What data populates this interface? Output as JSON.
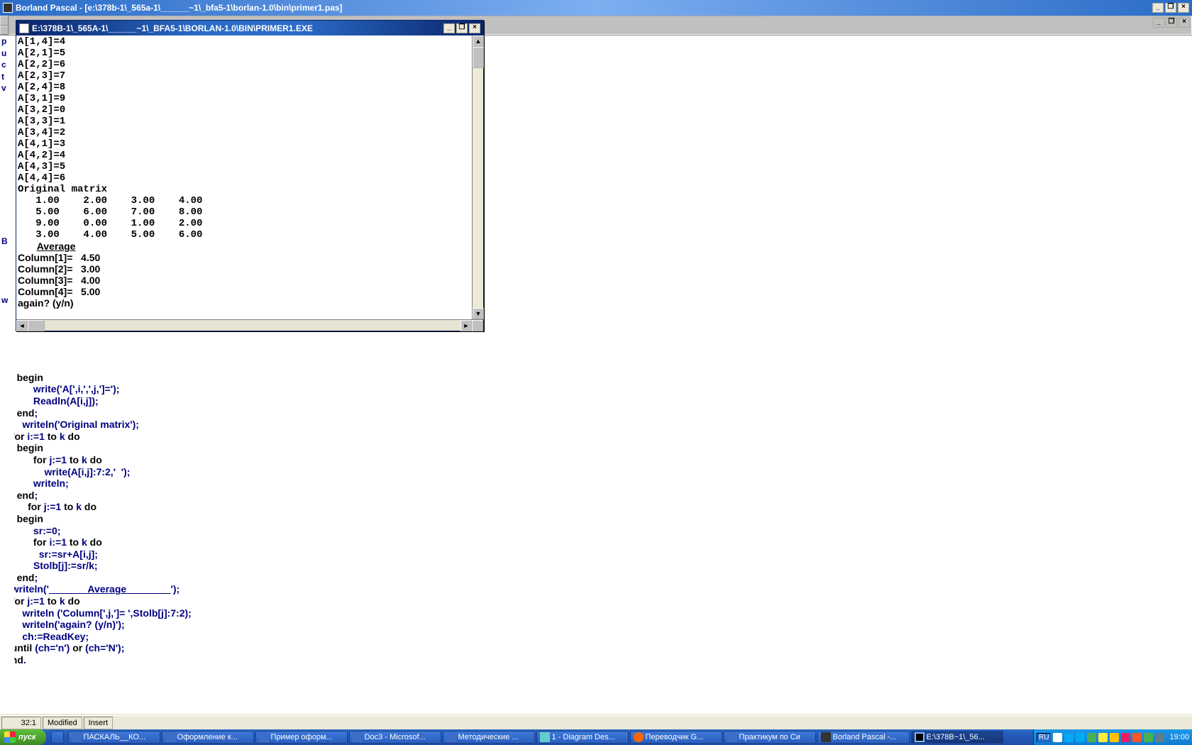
{
  "main_window": {
    "title": "Borland Pascal - [e:\\378b-1\\_565a-1\\______~1\\_bfa5-1\\borlan-1.0\\bin\\primer1.pas]"
  },
  "inner_window": {
    "title": "E:\\378B-1\\_565A-1\\______~1\\_BFA5-1\\BORLAN-1.0\\BIN\\PRIMER1.EXE"
  },
  "console_output": {
    "matrix_inputs": [
      "A[1,4]=4",
      "A[2,1]=5",
      "A[2,2]=6",
      "A[2,3]=7",
      "A[2,4]=8",
      "A[3,1]=9",
      "A[3,2]=0",
      "A[3,3]=1",
      "A[3,4]=2",
      "A[4,1]=3",
      "A[4,2]=4",
      "A[4,3]=5",
      "A[4,4]=6"
    ],
    "header1": "Original matrix",
    "matrix_rows": [
      "   1.00    2.00    3.00    4.00",
      "   5.00    6.00    7.00    8.00",
      "   9.00    0.00    1.00    2.00",
      "   3.00    4.00    5.00    6.00"
    ],
    "avg_header_pre": "       ",
    "avg_header_u": "Average",
    "columns": [
      "Column[1]=   4.50",
      "Column[2]=   3.00",
      "Column[3]=   4.00",
      "Column[4]=   5.00"
    ],
    "prompt": "again? (y/n)"
  },
  "left_strip": [
    "p",
    "u",
    "c",
    "t",
    "v",
    " ",
    " ",
    " ",
    " ",
    " ",
    " ",
    " ",
    " ",
    " ",
    " ",
    " ",
    " ",
    "B",
    " ",
    " ",
    " ",
    " ",
    "w"
  ],
  "source_lines": [
    {
      "indent": 4,
      "parts": [
        {
          "t": "begin",
          "c": "kw"
        }
      ]
    },
    {
      "indent": 10,
      "parts": [
        {
          "t": "write(",
          "c": "reg"
        },
        {
          "t": "'A['",
          "c": "str"
        },
        {
          "t": ",i,",
          "c": "reg"
        },
        {
          "t": "','",
          "c": "str"
        },
        {
          "t": ",j,",
          "c": "reg"
        },
        {
          "t": "']='",
          "c": "str"
        },
        {
          "t": ");",
          "c": "reg"
        }
      ]
    },
    {
      "indent": 10,
      "parts": [
        {
          "t": "Readln(A[i,j]);",
          "c": "reg"
        }
      ]
    },
    {
      "indent": 4,
      "parts": [
        {
          "t": "end",
          "c": "kw"
        },
        {
          "t": ";",
          "c": "reg"
        }
      ]
    },
    {
      "indent": 6,
      "parts": [
        {
          "t": "writeln(",
          "c": "reg"
        },
        {
          "t": "'Original matrix'",
          "c": "str"
        },
        {
          "t": ");",
          "c": "reg"
        }
      ]
    },
    {
      "indent": 2,
      "parts": [
        {
          "t": "for ",
          "c": "kw"
        },
        {
          "t": "i:=1 ",
          "c": "reg"
        },
        {
          "t": "to ",
          "c": "kw"
        },
        {
          "t": "k ",
          "c": "reg"
        },
        {
          "t": "do",
          "c": "kw"
        }
      ]
    },
    {
      "indent": 4,
      "parts": [
        {
          "t": "begin",
          "c": "kw"
        }
      ]
    },
    {
      "indent": 10,
      "parts": [
        {
          "t": "for ",
          "c": "kw"
        },
        {
          "t": "j:=1 ",
          "c": "reg"
        },
        {
          "t": "to ",
          "c": "kw"
        },
        {
          "t": "k ",
          "c": "reg"
        },
        {
          "t": "do",
          "c": "kw"
        }
      ]
    },
    {
      "indent": 14,
      "parts": [
        {
          "t": "write(A[i,j]:7:2,",
          "c": "reg"
        },
        {
          "t": "'  '",
          "c": "str"
        },
        {
          "t": ");",
          "c": "reg"
        }
      ]
    },
    {
      "indent": 10,
      "parts": [
        {
          "t": "writeln;",
          "c": "reg"
        }
      ]
    },
    {
      "indent": 4,
      "parts": [
        {
          "t": "end",
          "c": "kw"
        },
        {
          "t": ";",
          "c": "reg"
        }
      ]
    },
    {
      "indent": 8,
      "parts": [
        {
          "t": "for ",
          "c": "kw"
        },
        {
          "t": "j:=1 ",
          "c": "reg"
        },
        {
          "t": "to ",
          "c": "kw"
        },
        {
          "t": "k ",
          "c": "reg"
        },
        {
          "t": "do",
          "c": "kw"
        }
      ]
    },
    {
      "indent": 4,
      "parts": [
        {
          "t": "begin",
          "c": "kw"
        }
      ]
    },
    {
      "indent": 10,
      "parts": [
        {
          "t": "sr:=0;",
          "c": "reg"
        }
      ]
    },
    {
      "indent": 10,
      "parts": [
        {
          "t": "for ",
          "c": "kw"
        },
        {
          "t": "i:=1 ",
          "c": "reg"
        },
        {
          "t": "to ",
          "c": "kw"
        },
        {
          "t": "k ",
          "c": "reg"
        },
        {
          "t": "do",
          "c": "kw"
        }
      ]
    },
    {
      "indent": 12,
      "parts": [
        {
          "t": "sr:=sr+A[i,j];",
          "c": "reg"
        }
      ]
    },
    {
      "indent": 10,
      "parts": [
        {
          "t": "Stolb[j]:=sr/k;",
          "c": "reg"
        }
      ]
    },
    {
      "indent": 4,
      "parts": [
        {
          "t": "end",
          "c": "kw"
        },
        {
          "t": ";",
          "c": "reg"
        }
      ]
    },
    {
      "indent": 2,
      "parts": [
        {
          "t": "writeln(",
          "c": "reg"
        },
        {
          "t": "'",
          "c": "str"
        },
        {
          "t": "_______",
          "c": "str",
          "u": true
        },
        {
          "t": "Average",
          "c": "str",
          "u": true
        },
        {
          "t": "________",
          "c": "str",
          "u": true
        },
        {
          "t": "'",
          "c": "str"
        },
        {
          "t": ");",
          "c": "reg"
        }
      ]
    },
    {
      "indent": 2,
      "parts": [
        {
          "t": "for ",
          "c": "kw"
        },
        {
          "t": "j:=1 ",
          "c": "reg"
        },
        {
          "t": "to ",
          "c": "kw"
        },
        {
          "t": "k ",
          "c": "reg"
        },
        {
          "t": "do",
          "c": "kw"
        }
      ]
    },
    {
      "indent": 6,
      "parts": [
        {
          "t": "writeln (",
          "c": "reg"
        },
        {
          "t": "'Column['",
          "c": "str"
        },
        {
          "t": ",j,",
          "c": "reg"
        },
        {
          "t": "']= '",
          "c": "str"
        },
        {
          "t": ",Stolb[j]:7:2);",
          "c": "reg"
        }
      ]
    },
    {
      "indent": 6,
      "parts": [
        {
          "t": "writeln(",
          "c": "reg"
        },
        {
          "t": "'again? (y/n)'",
          "c": "str"
        },
        {
          "t": ");",
          "c": "reg"
        }
      ]
    },
    {
      "indent": 6,
      "parts": [
        {
          "t": "ch:=ReadKey;",
          "c": "reg"
        }
      ]
    },
    {
      "indent": 2,
      "parts": [
        {
          "t": "until ",
          "c": "kw"
        },
        {
          "t": "(ch=",
          "c": "reg"
        },
        {
          "t": "'n'",
          "c": "str"
        },
        {
          "t": ") ",
          "c": "reg"
        },
        {
          "t": "or ",
          "c": "kw"
        },
        {
          "t": "(ch=",
          "c": "reg"
        },
        {
          "t": "'N'",
          "c": "str"
        },
        {
          "t": ");",
          "c": "reg"
        }
      ]
    },
    {
      "indent": 0,
      "parts": [
        {
          "t": "end",
          "c": "kw"
        },
        {
          "t": ".",
          "c": "reg"
        }
      ]
    }
  ],
  "statusbar": {
    "pos": "32:1",
    "modified": "Modified",
    "insert": "Insert"
  },
  "taskbar": {
    "start": "пуск",
    "tasks": [
      {
        "label": "ПАСКАЛЬ__КО...",
        "icon": "word"
      },
      {
        "label": "Оформление к...",
        "icon": "word"
      },
      {
        "label": "Пример оформ...",
        "icon": "word"
      },
      {
        "label": "Doc3 - Microsof...",
        "icon": "word"
      },
      {
        "label": "Методические ...",
        "icon": "word"
      },
      {
        "label": "1 - Diagram Des...",
        "icon": "dd"
      },
      {
        "label": "Переводчик G...",
        "icon": "ff"
      },
      {
        "label": "Практикум по Си",
        "icon": "word"
      },
      {
        "label": "Borland Pascal -...",
        "icon": "bp"
      },
      {
        "label": "E:\\378B~1\\_56...",
        "icon": "exe",
        "active": true
      }
    ],
    "lang": "RU",
    "clock": "19:00"
  }
}
